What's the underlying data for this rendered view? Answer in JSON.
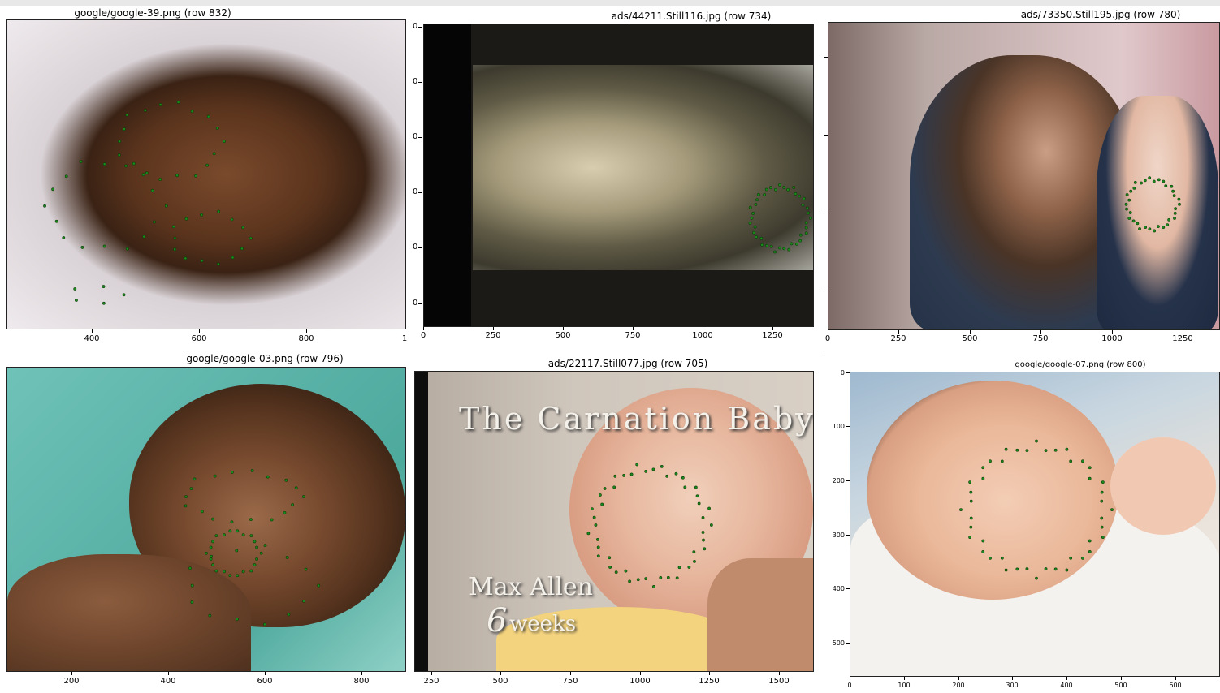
{
  "panels": [
    {
      "title": "google/google-39.png (row 832)",
      "xticks": [
        "400",
        "600",
        "800",
        "1"
      ],
      "yticks": []
    },
    {
      "title": "ads/44211.Still116.jpg (row 734)",
      "xticks": [
        "0",
        "250",
        "500",
        "750",
        "1000",
        "1250"
      ],
      "yticks": [
        "0",
        "0",
        "0",
        "0",
        "0",
        "0"
      ]
    },
    {
      "title": "ads/73350.Still195.jpg (row 780)",
      "xticks": [
        "0",
        "250",
        "500",
        "750",
        "1000",
        "1250"
      ],
      "yticks": []
    },
    {
      "title": "google/google-03.png (row 796)",
      "xticks": [
        "200",
        "400",
        "600",
        "800"
      ],
      "yticks": []
    },
    {
      "title": "ads/22117.Still077.jpg (row 705)",
      "xticks": [
        "250",
        "500",
        "750",
        "1000",
        "1250",
        "1500"
      ],
      "yticks": [],
      "overlay": {
        "headline": "The Carnation Baby",
        "name": "Max Allen",
        "age_number": "6",
        "age_unit": "weeks"
      }
    },
    {
      "title": "google/google-07.png (row 800)",
      "xticks": [
        "0",
        "100",
        "200",
        "300",
        "400",
        "500",
        "600"
      ],
      "yticks": [
        "0",
        "100",
        "200",
        "300",
        "400",
        "500"
      ]
    }
  ],
  "colors": {
    "landmark_fill": "#1b8a1b",
    "landmark_stroke": "#0a3d0a",
    "topbar": "#e8e8e8"
  }
}
